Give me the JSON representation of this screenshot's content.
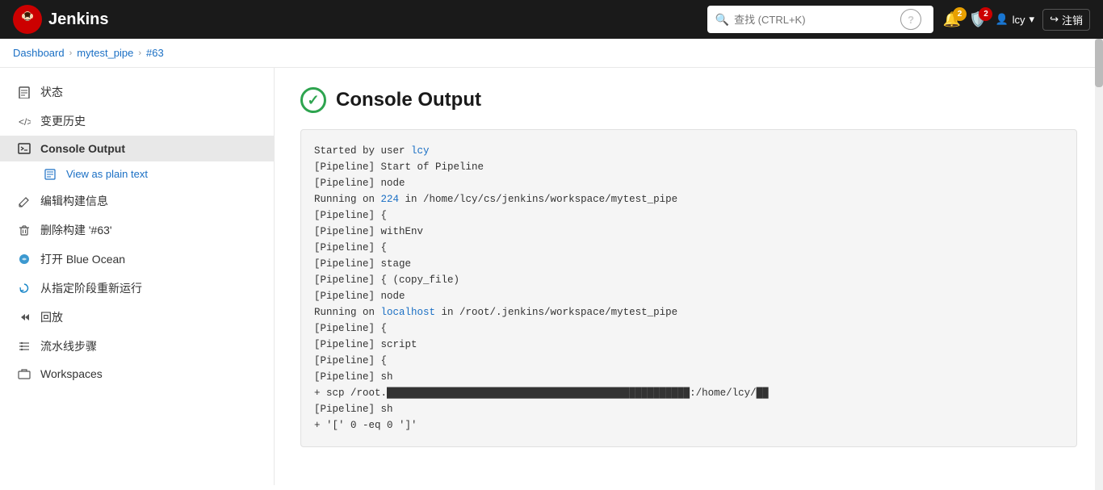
{
  "header": {
    "logo_text": "Jenkins",
    "search_placeholder": "查找 (CTRL+K)",
    "help_label": "?",
    "notif_count": "2",
    "shield_count": "2",
    "user_label": "lcy",
    "logout_label": "注销"
  },
  "breadcrumb": {
    "items": [
      {
        "label": "Dashboard",
        "href": "#"
      },
      {
        "label": "mytest_pipe",
        "href": "#"
      },
      {
        "label": "#63",
        "href": "#"
      }
    ]
  },
  "sidebar": {
    "items": [
      {
        "id": "status",
        "icon": "📄",
        "label": "状态",
        "active": false
      },
      {
        "id": "changes",
        "icon": "</>",
        "label": "变更历史",
        "active": false
      },
      {
        "id": "console",
        "icon": ">_",
        "label": "Console Output",
        "active": true
      },
      {
        "id": "plain-text",
        "icon": "📄",
        "label": "View as plain text",
        "active": false,
        "sub": true
      },
      {
        "id": "edit-build",
        "icon": "✏️",
        "label": "编辑构建信息",
        "active": false
      },
      {
        "id": "delete-build",
        "icon": "🗑️",
        "label": "删除构建 '#63'",
        "active": false
      },
      {
        "id": "blue-ocean",
        "icon": "🔵",
        "label": "打开 Blue Ocean",
        "active": false
      },
      {
        "id": "restart-stage",
        "icon": "🔄",
        "label": "从指定阶段重新运行",
        "active": false
      },
      {
        "id": "rollback",
        "icon": "↩️",
        "label": "回放",
        "active": false
      },
      {
        "id": "pipeline-steps",
        "icon": "≡",
        "label": "流水线步骤",
        "active": false
      },
      {
        "id": "workspaces",
        "icon": "📁",
        "label": "Workspaces",
        "active": false
      }
    ]
  },
  "console": {
    "title": "Console Output",
    "lines": [
      {
        "text": "Started by user ",
        "link": "lcy",
        "link_href": "#",
        "rest": ""
      },
      {
        "text": "[Pipeline] Start of Pipeline",
        "link": null
      },
      {
        "text": "[Pipeline] node",
        "link": null
      },
      {
        "text": "Running on ",
        "link": "224",
        "link_href": "#",
        "rest": " in /home/lcy/cs/jenkins/workspace/mytest_pipe"
      },
      {
        "text": "[Pipeline] {",
        "link": null
      },
      {
        "text": "[Pipeline] withEnv",
        "link": null
      },
      {
        "text": "[Pipeline] {",
        "link": null
      },
      {
        "text": "[Pipeline] stage",
        "link": null
      },
      {
        "text": "[Pipeline] { (copy_file)",
        "link": null
      },
      {
        "text": "[Pipeline] node",
        "link": null
      },
      {
        "text": "Running on ",
        "link": "localhost",
        "link_href": "#",
        "rest": " in /root/.jenkins/workspace/mytest_pipe"
      },
      {
        "text": "[Pipeline] {",
        "link": null
      },
      {
        "text": "[Pipeline] script",
        "link": null
      },
      {
        "text": "[Pipeline] {",
        "link": null
      },
      {
        "text": "[Pipeline] sh",
        "link": null
      },
      {
        "text": "+ scp /root.████████████████████████████████████████:/home/lcy/█",
        "link": null
      },
      {
        "text": "[Pipeline] sh",
        "link": null
      },
      {
        "text": "+ '[' 0 -eq 0 ']'",
        "link": null
      }
    ]
  }
}
